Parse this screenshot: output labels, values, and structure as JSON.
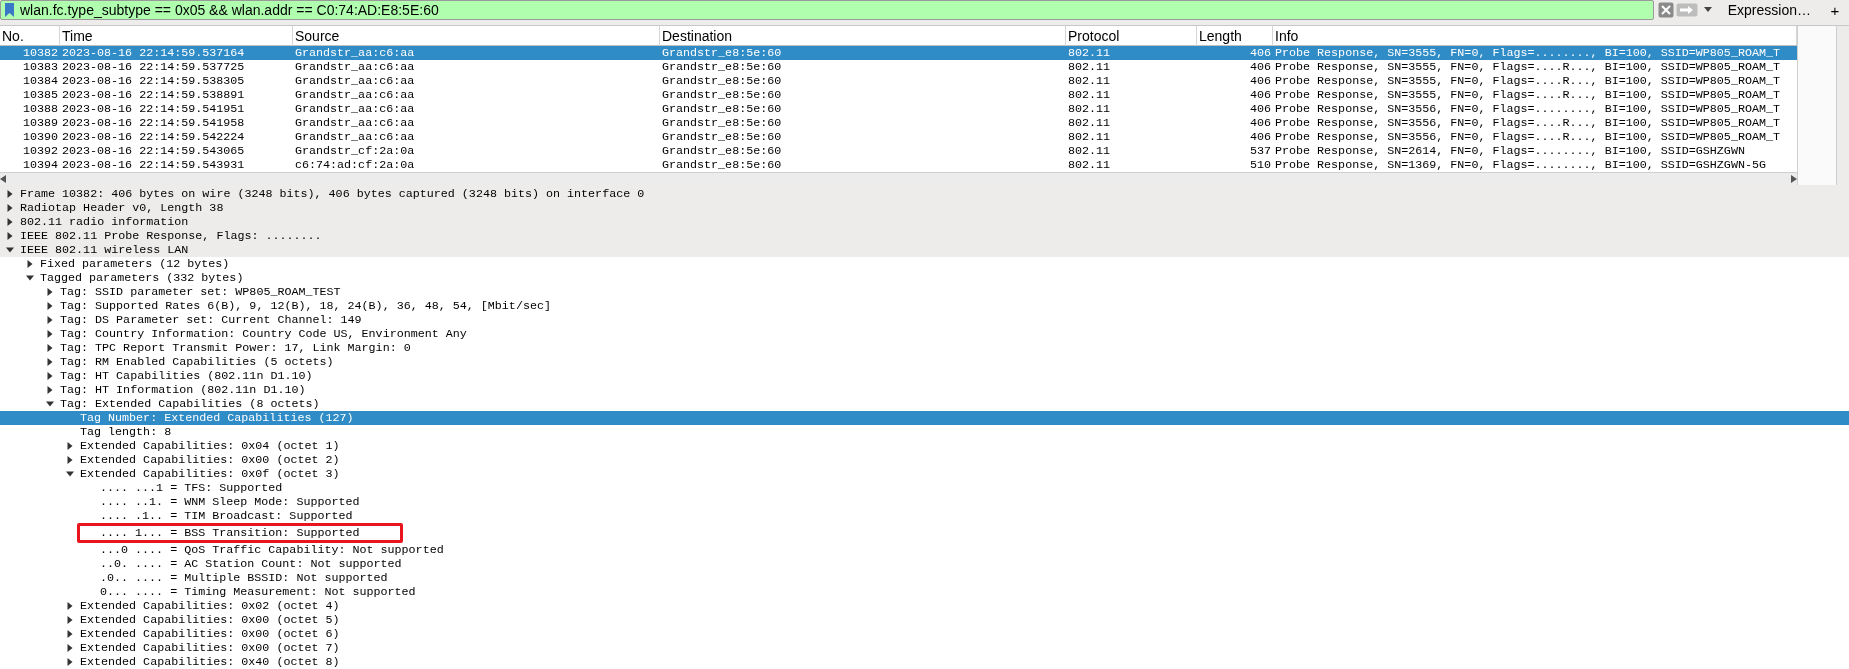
{
  "filter": {
    "value": "wlan.fc.type_subtype == 0x05 && wlan.addr == C0:74:AD:E8:5E:60",
    "valid": true,
    "expression": "Expression…",
    "add": "+"
  },
  "packet_list": {
    "columns": [
      {
        "label": "No."
      },
      {
        "label": "Time"
      },
      {
        "label": "Source"
      },
      {
        "label": "Destination"
      },
      {
        "label": "Protocol"
      },
      {
        "label": "Length"
      },
      {
        "label": "Info"
      }
    ],
    "rows": [
      {
        "cells": [
          "10382",
          "2023-08-16 22:14:59.537164",
          "Grandstr_aa:c6:aa",
          "Grandstr_e8:5e:60",
          "802.11",
          "406",
          "Probe Response, SN=3555, FN=0, Flags=........, BI=100, SSID=WP805_ROAM_T"
        ],
        "selected": true
      },
      {
        "cells": [
          "10383",
          "2023-08-16 22:14:59.537725",
          "Grandstr_aa:c6:aa",
          "Grandstr_e8:5e:60",
          "802.11",
          "406",
          "Probe Response, SN=3555, FN=0, Flags=....R..., BI=100, SSID=WP805_ROAM_T"
        ],
        "selected": false
      },
      {
        "cells": [
          "10384",
          "2023-08-16 22:14:59.538305",
          "Grandstr_aa:c6:aa",
          "Grandstr_e8:5e:60",
          "802.11",
          "406",
          "Probe Response, SN=3555, FN=0, Flags=....R..., BI=100, SSID=WP805_ROAM_T"
        ],
        "selected": false
      },
      {
        "cells": [
          "10385",
          "2023-08-16 22:14:59.538891",
          "Grandstr_aa:c6:aa",
          "Grandstr_e8:5e:60",
          "802.11",
          "406",
          "Probe Response, SN=3555, FN=0, Flags=....R..., BI=100, SSID=WP805_ROAM_T"
        ],
        "selected": false
      },
      {
        "cells": [
          "10388",
          "2023-08-16 22:14:59.541951",
          "Grandstr_aa:c6:aa",
          "Grandstr_e8:5e:60",
          "802.11",
          "406",
          "Probe Response, SN=3556, FN=0, Flags=........, BI=100, SSID=WP805_ROAM_T"
        ],
        "selected": false
      },
      {
        "cells": [
          "10389",
          "2023-08-16 22:14:59.541958",
          "Grandstr_aa:c6:aa",
          "Grandstr_e8:5e:60",
          "802.11",
          "406",
          "Probe Response, SN=3556, FN=0, Flags=....R..., BI=100, SSID=WP805_ROAM_T"
        ],
        "selected": false
      },
      {
        "cells": [
          "10390",
          "2023-08-16 22:14:59.542224",
          "Grandstr_aa:c6:aa",
          "Grandstr_e8:5e:60",
          "802.11",
          "406",
          "Probe Response, SN=3556, FN=0, Flags=....R..., BI=100, SSID=WP805_ROAM_T"
        ],
        "selected": false
      },
      {
        "cells": [
          "10392",
          "2023-08-16 22:14:59.543065",
          "Grandstr_cf:2a:0a",
          "Grandstr_e8:5e:60",
          "802.11",
          "537",
          "Probe Response, SN=2614, FN=0, Flags=........, BI=100, SSID=GSHZGWN"
        ],
        "selected": false
      },
      {
        "cells": [
          "10394",
          "2023-08-16 22:14:59.543931",
          "c6:74:ad:cf:2a:0a",
          "Grandstr_e8:5e:60",
          "802.11",
          "510",
          "Probe Response, SN=1369, FN=0, Flags=........, BI=100, SSID=GSHZGWN-5G"
        ],
        "selected": false
      }
    ]
  },
  "details": [
    {
      "label": "Frame 10382: 406 bytes on wire (3248 bits), 406 bytes captured (3248 bits) on interface 0",
      "expanded": false,
      "selected": false
    },
    {
      "label": "Radiotap Header v0, Length 38",
      "expanded": false,
      "selected": false
    },
    {
      "label": "802.11 radio information",
      "expanded": false,
      "selected": false
    },
    {
      "label": "IEEE 802.11 Probe Response, Flags: ........",
      "expanded": false,
      "selected": false
    },
    {
      "label": "IEEE 802.11 wireless LAN",
      "expanded": true,
      "selected": false,
      "children": [
        {
          "label": "Fixed parameters (12 bytes)",
          "expanded": false,
          "selected": false
        },
        {
          "label": "Tagged parameters (332 bytes)",
          "expanded": true,
          "selected": false,
          "children": [
            {
              "label": "Tag: SSID parameter set: WP805_ROAM_TEST",
              "expanded": false,
              "selected": false
            },
            {
              "label": "Tag: Supported Rates 6(B), 9, 12(B), 18, 24(B), 36, 48, 54, [Mbit/sec]",
              "expanded": false,
              "selected": false
            },
            {
              "label": "Tag: DS Parameter set: Current Channel: 149",
              "expanded": false,
              "selected": false
            },
            {
              "label": "Tag: Country Information: Country Code US, Environment Any",
              "expanded": false,
              "selected": false
            },
            {
              "label": "Tag: TPC Report Transmit Power: 17, Link Margin: 0",
              "expanded": false,
              "selected": false
            },
            {
              "label": "Tag: RM Enabled Capabilities (5 octets)",
              "expanded": false,
              "selected": false
            },
            {
              "label": "Tag: HT Capabilities (802.11n D1.10)",
              "expanded": false,
              "selected": false
            },
            {
              "label": "Tag: HT Information (802.11n D1.10)",
              "expanded": false,
              "selected": false
            },
            {
              "label": "Tag: Extended Capabilities (8 octets)",
              "expanded": true,
              "selected": false,
              "children": [
                {
                  "label": "Tag Number: Extended Capabilities (127)",
                  "selected": true
                },
                {
                  "label": "Tag length: 8",
                  "selected": false
                },
                {
                  "label": "Extended Capabilities: 0x04 (octet 1)",
                  "expanded": false,
                  "selected": false
                },
                {
                  "label": "Extended Capabilities: 0x00 (octet 2)",
                  "expanded": false,
                  "selected": false
                },
                {
                  "label": "Extended Capabilities: 0x0f (octet 3)",
                  "expanded": true,
                  "selected": false,
                  "children": [
                    {
                      "label": ".... ...1 = TFS: Supported",
                      "selected": false,
                      "boxed": false
                    },
                    {
                      "label": ".... ..1. = WNM Sleep Mode: Supported",
                      "selected": false,
                      "boxed": false
                    },
                    {
                      "label": ".... .1.. = TIM Broadcast: Supported",
                      "selected": false,
                      "boxed": false
                    },
                    {
                      "label": ".... 1... = BSS Transition: Supported",
                      "selected": false,
                      "boxed": true
                    },
                    {
                      "label": "...0 .... = QoS Traffic Capability: Not supported",
                      "selected": false,
                      "boxed": false
                    },
                    {
                      "label": "..0. .... = AC Station Count: Not supported",
                      "selected": false,
                      "boxed": false
                    },
                    {
                      "label": ".0.. .... = Multiple BSSID: Not supported",
                      "selected": false,
                      "boxed": false
                    },
                    {
                      "label": "0... .... = Timing Measurement: Not supported",
                      "selected": false,
                      "boxed": false
                    }
                  ]
                },
                {
                  "label": "Extended Capabilities: 0x02 (octet 4)",
                  "expanded": false,
                  "selected": false
                },
                {
                  "label": "Extended Capabilities: 0x00 (octet 5)",
                  "expanded": false,
                  "selected": false
                },
                {
                  "label": "Extended Capabilities: 0x00 (octet 6)",
                  "expanded": false,
                  "selected": false
                },
                {
                  "label": "Extended Capabilities: 0x00 (octet 7)",
                  "expanded": false,
                  "selected": false
                },
                {
                  "label": "Extended Capabilities: 0x40 (octet 8)",
                  "expanded": false,
                  "selected": false
                }
              ]
            }
          ]
        }
      ]
    }
  ]
}
